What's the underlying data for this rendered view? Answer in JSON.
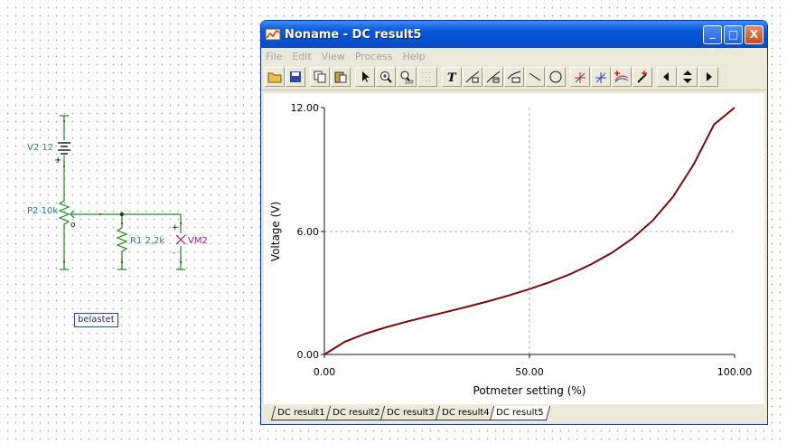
{
  "schematic": {
    "source_label": "V2 12",
    "source_plus": "+",
    "pot_label": "P2 10k",
    "pot_wiper": "o",
    "resistor_label": "R1 2,2k",
    "meter_label": "VM2",
    "meter_plus": "+",
    "meter_minus": "-",
    "tag": "belastet"
  },
  "window": {
    "title": "Noname - DC result5",
    "buttons": {
      "minimize": "_",
      "maximize": "□",
      "close": "X"
    },
    "menu": [
      "File",
      "Edit",
      "View",
      "Process",
      "Help"
    ],
    "toolbar_icons": [
      "open-folder-icon",
      "save-icon",
      "copy-icon",
      "paste-icon",
      "pointer-icon",
      "zoom-in-icon",
      "zoom-100-icon",
      "grid-icon",
      "text-icon",
      "annotate-1-icon",
      "annotate-2-icon",
      "annotate-3-icon",
      "line-icon",
      "circle-icon",
      "cursor-a-icon",
      "cursor-b-icon",
      "add-curve-icon",
      "pipette-icon",
      "move-left-icon",
      "move-updown-icon",
      "move-right-icon"
    ],
    "tabs": [
      "DC result1",
      "DC result2",
      "DC result3",
      "DC result4",
      "DC result5"
    ],
    "active_tab": "DC result5"
  },
  "chart_data": {
    "type": "line",
    "title": "",
    "xlabel": "Potmeter setting (%)",
    "ylabel": "Voltage (V)",
    "xlim": [
      0,
      100
    ],
    "ylim": [
      0,
      12
    ],
    "xticks": [
      "0.00",
      "50.00",
      "100.00"
    ],
    "yticks": [
      "0.00",
      "6.00",
      "12.00"
    ],
    "grid": "dashed",
    "line_color": "#7a0a0a",
    "series": [
      {
        "x": [
          0,
          5,
          10,
          15,
          20,
          25,
          30,
          35,
          40,
          45,
          50,
          55,
          60,
          65,
          70,
          75,
          80,
          85,
          90,
          95,
          100
        ],
        "y": [
          0,
          0.62,
          1.01,
          1.32,
          1.59,
          1.84,
          2.08,
          2.33,
          2.59,
          2.87,
          3.18,
          3.52,
          3.91,
          4.38,
          4.93,
          5.62,
          6.5,
          7.67,
          9.23,
          11.18,
          12.0
        ]
      }
    ]
  }
}
